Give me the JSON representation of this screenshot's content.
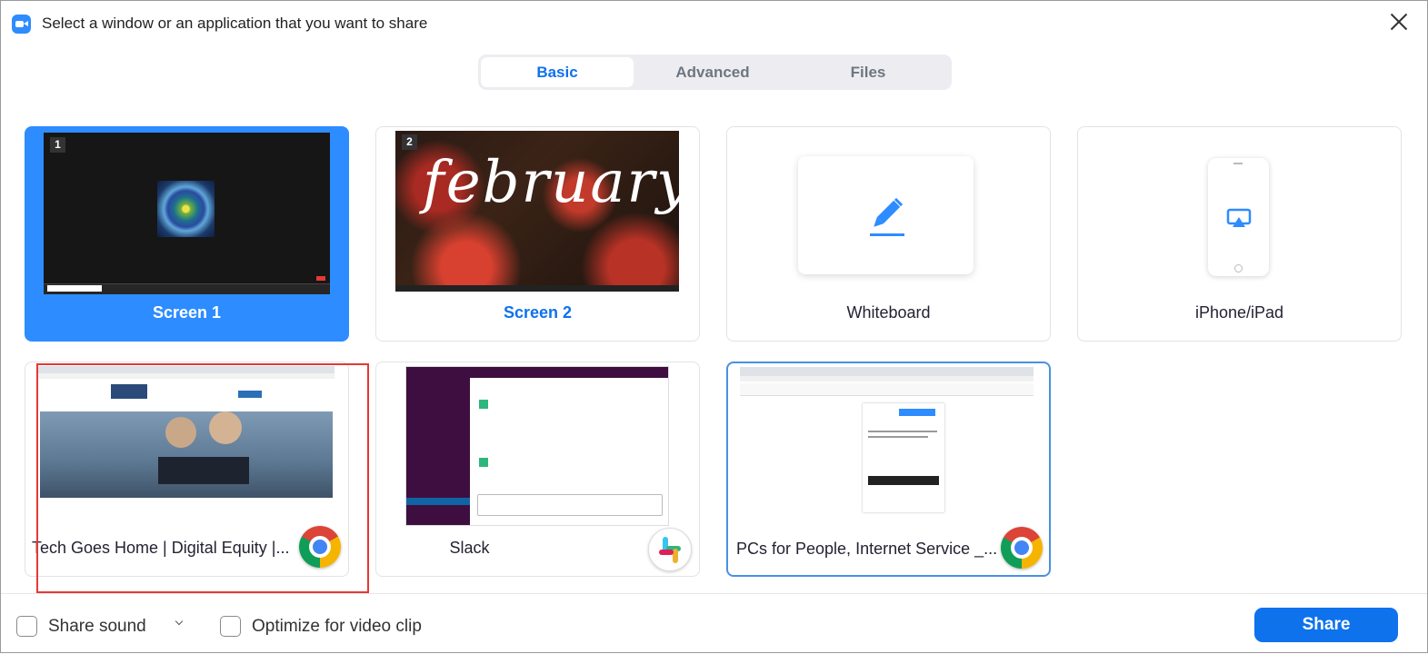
{
  "window": {
    "title": "Select a window or an application that you want to share"
  },
  "tabs": [
    {
      "label": "Basic",
      "active": true
    },
    {
      "label": "Advanced",
      "active": false
    },
    {
      "label": "Files",
      "active": false
    }
  ],
  "cards": [
    {
      "label": "Screen 1",
      "number": "1",
      "selected": true
    },
    {
      "label": "Screen 2",
      "number": "2",
      "thumb_text": "february"
    },
    {
      "label": "Whiteboard"
    },
    {
      "label": "iPhone/iPad"
    },
    {
      "label": "Tech Goes Home | Digital Equity |...",
      "app_icon": "chrome-icon"
    },
    {
      "label": "Slack",
      "app_icon": "slack-icon"
    },
    {
      "label": "PCs for People, Internet Service _...",
      "app_icon": "chrome-icon"
    }
  ],
  "footer": {
    "share_sound": "Share sound",
    "optimize": "Optimize for video clip",
    "share_button": "Share"
  },
  "colors": {
    "accent": "#0e72ed",
    "selected_card": "#2d8cff",
    "highlight_box": "#e53935"
  }
}
